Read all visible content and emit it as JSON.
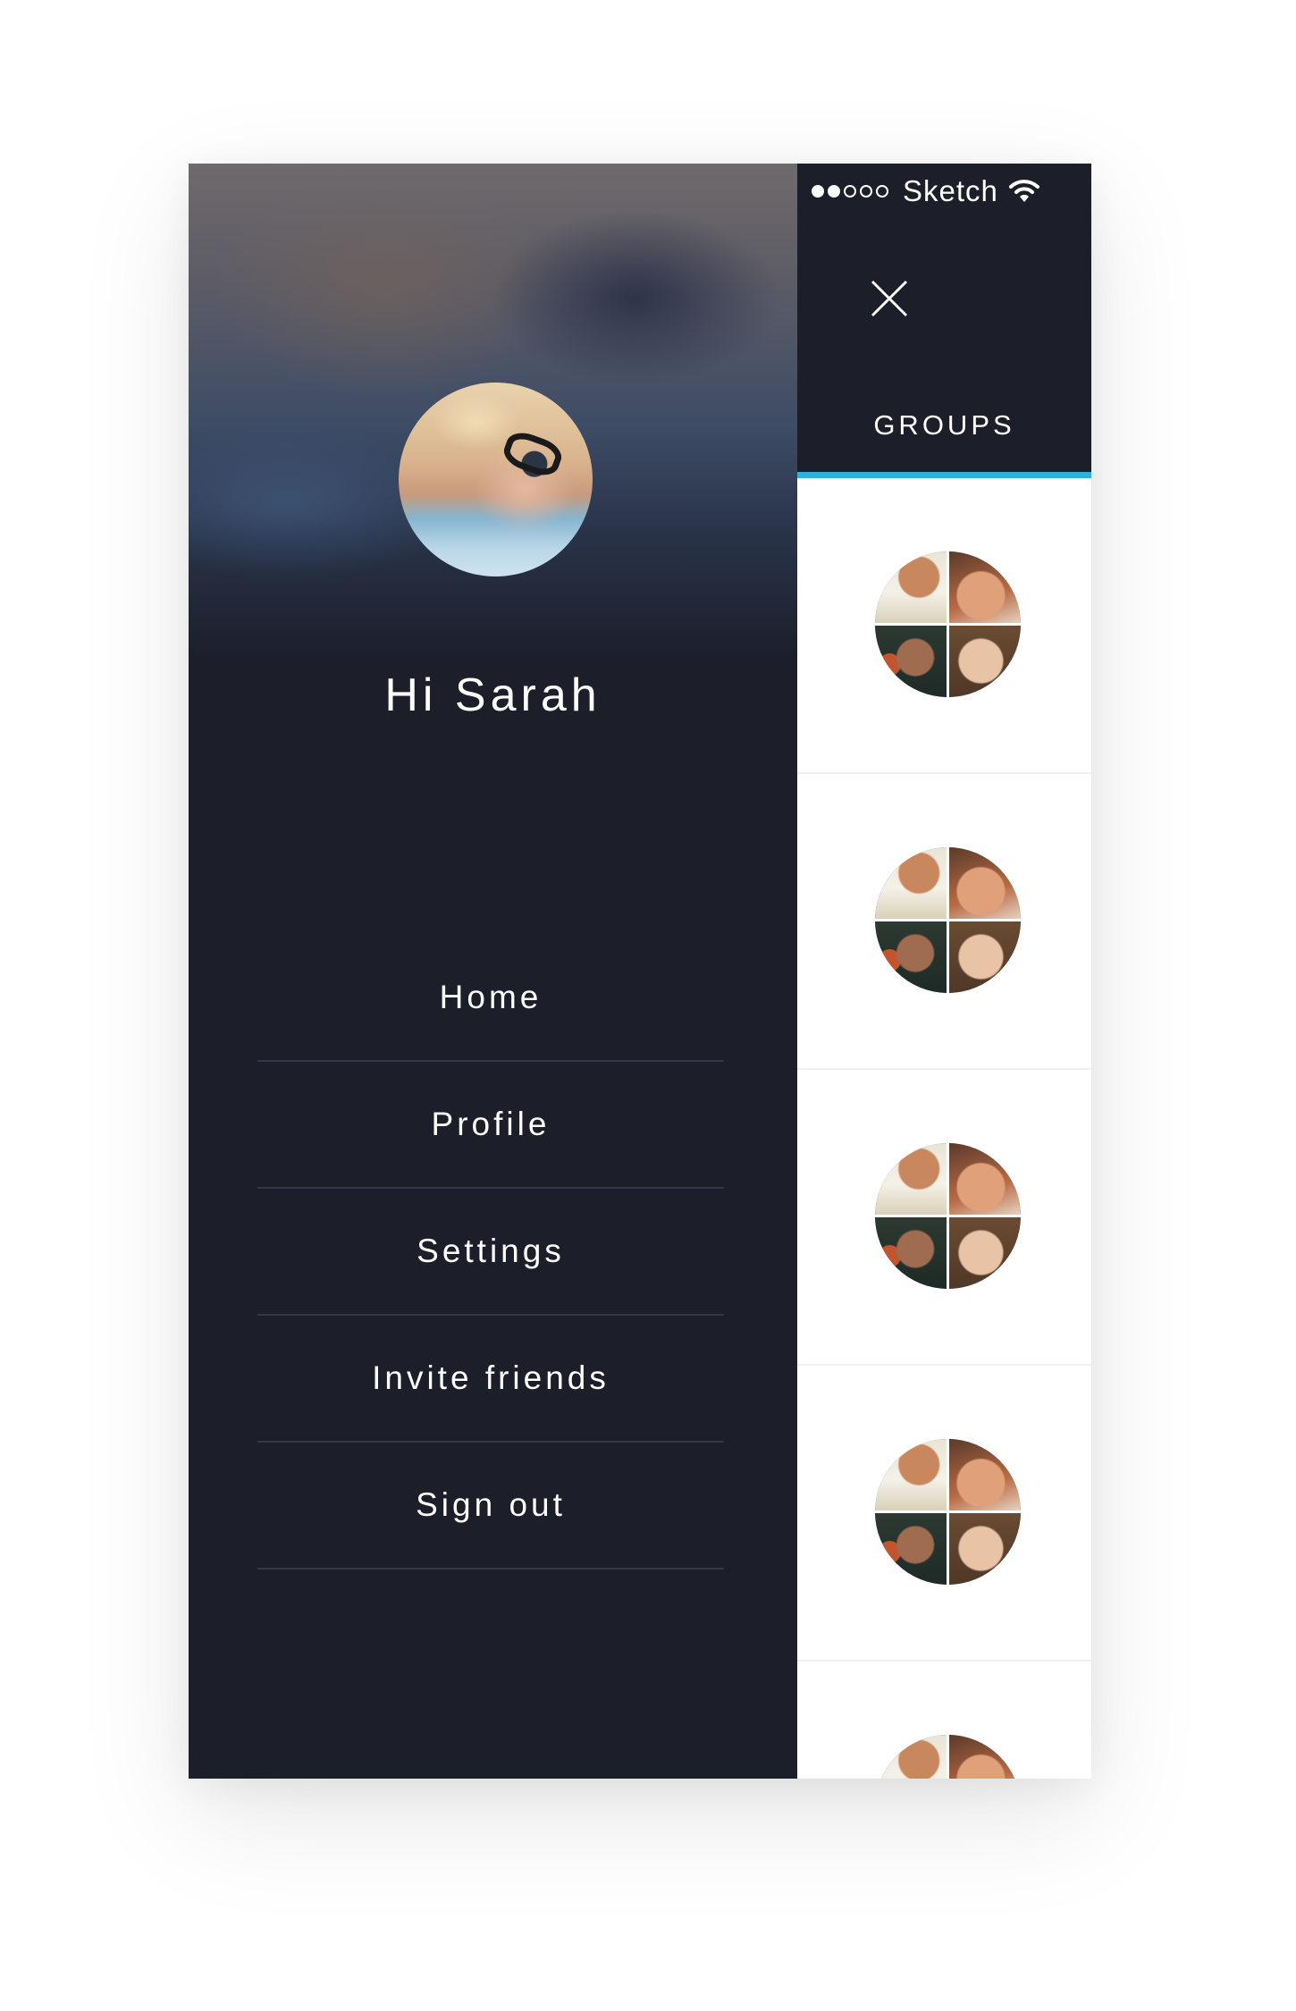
{
  "status_bar": {
    "carrier": "Sketch",
    "signal_filled": 2,
    "signal_total": 5,
    "wifi_icon": "wifi-icon"
  },
  "drawer": {
    "greeting": "Hi Sarah",
    "menu_items": [
      {
        "label": "Home"
      },
      {
        "label": "Profile"
      },
      {
        "label": "Settings"
      },
      {
        "label": "Invite friends"
      },
      {
        "label": "Sign out"
      }
    ]
  },
  "right_panel": {
    "close_icon": "close-icon",
    "tab_label": "GROUPS",
    "accent_color": "#33aedc",
    "groups_count_visible": 5
  },
  "colors": {
    "drawer_bg": "#1c1e2a",
    "divider": "#343748",
    "accent": "#33aedc"
  }
}
